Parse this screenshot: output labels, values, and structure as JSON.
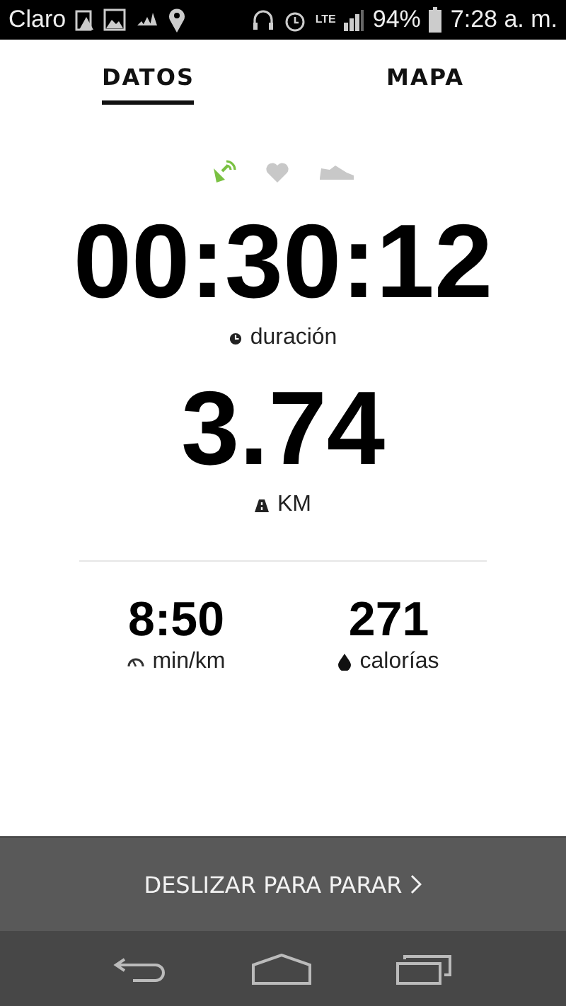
{
  "status_bar": {
    "carrier": "Claro",
    "network": "LTE",
    "battery": "94%",
    "time": "7:28 a. m."
  },
  "tabs": [
    {
      "label": "DATOS",
      "selected": true
    },
    {
      "label": "MAPA",
      "selected": false
    }
  ],
  "sensors": [
    {
      "kind": "gps",
      "active": true
    },
    {
      "kind": "heart",
      "active": false
    },
    {
      "kind": "shoe",
      "active": false
    }
  ],
  "duration": {
    "value": "00:30:12",
    "label": "duración"
  },
  "distance": {
    "value": "3.74",
    "label": "KM"
  },
  "stats": [
    {
      "kind": "pace",
      "value": "8:50",
      "label": "min/km"
    },
    {
      "kind": "calories",
      "value": "271",
      "label": "calorías"
    }
  ],
  "slide_button": {
    "label": "DESLIZAR PARA PARAR"
  }
}
